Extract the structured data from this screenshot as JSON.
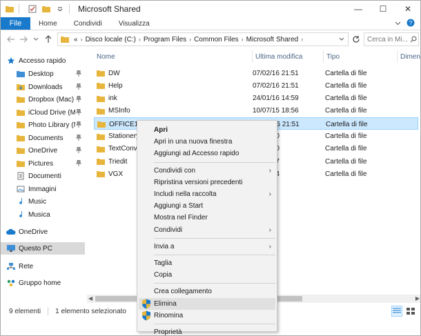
{
  "window": {
    "title": "Microsoft Shared",
    "controls": {
      "minimize": "—",
      "maximize": "☐",
      "close": "✕"
    }
  },
  "ribbon": {
    "tabs": [
      "File",
      "Home",
      "Condividi",
      "Visualizza"
    ]
  },
  "address": {
    "prefix": "«",
    "segments": [
      "Disco locale (C:)",
      "Program Files",
      "Common Files",
      "Microsoft Shared"
    ],
    "search_placeholder": "Cerca in Mi..."
  },
  "sidebar": {
    "items": [
      {
        "label": "Accesso rapido",
        "icon": "star-icon",
        "pin": false
      },
      {
        "label": "Desktop",
        "icon": "folder-blue-icon",
        "pin": true
      },
      {
        "label": "Downloads",
        "icon": "download-icon",
        "pin": true
      },
      {
        "label": "Dropbox (Mac)",
        "icon": "folder-icon",
        "pin": true
      },
      {
        "label": "iCloud Drive (Ma",
        "icon": "folder-icon",
        "pin": true
      },
      {
        "label": "Photo Library (M",
        "icon": "folder-icon",
        "pin": true
      },
      {
        "label": "Documents",
        "icon": "folder-icon",
        "pin": true
      },
      {
        "label": "OneDrive",
        "icon": "folder-icon",
        "pin": true
      },
      {
        "label": "Pictures",
        "icon": "folder-icon",
        "pin": true
      },
      {
        "label": "Documenti",
        "icon": "documents-icon",
        "pin": false
      },
      {
        "label": "Immagini",
        "icon": "pictures-icon",
        "pin": false
      },
      {
        "label": "Music",
        "icon": "music-icon",
        "pin": false
      },
      {
        "label": "Musica",
        "icon": "music-icon",
        "pin": false
      },
      {
        "label": "OneDrive",
        "icon": "cloud-icon",
        "pin": false
      },
      {
        "label": "Questo PC",
        "icon": "computer-icon",
        "pin": false,
        "selected": true
      },
      {
        "label": "Rete",
        "icon": "network-icon",
        "pin": false
      },
      {
        "label": "Gruppo home",
        "icon": "homegroup-icon",
        "pin": false
      }
    ]
  },
  "columns": [
    "Nome",
    "Ultima modifica",
    "Tipo",
    "Dimensi"
  ],
  "files": [
    {
      "name": "DW",
      "date": "07/02/16 21:51",
      "type": "Cartella di file"
    },
    {
      "name": "Help",
      "date": "07/02/16 21:51",
      "type": "Cartella di file"
    },
    {
      "name": "ink",
      "date": "24/01/16 14:59",
      "type": "Cartella di file"
    },
    {
      "name": "MSInfo",
      "date": "10/07/15 18:56",
      "type": "Cartella di file"
    },
    {
      "name": "OFFICE15",
      "date": "07/02/16 21:51",
      "type": "Cartella di file",
      "selected": true
    },
    {
      "name": "Stationery",
      "date": "15 19:00",
      "type": "Cartella di file"
    },
    {
      "name": "TextConv",
      "date": "16 21:50",
      "type": "Cartella di file"
    },
    {
      "name": "Triedit",
      "date": "16 14:57",
      "type": "Cartella di file"
    },
    {
      "name": "VGX",
      "date": "15 13:04",
      "type": "Cartella di file"
    }
  ],
  "status": {
    "count": "9 elementi",
    "selection": "1 elemento selezionato"
  },
  "context_menu": {
    "items": [
      {
        "label": "Apri",
        "bold": true
      },
      {
        "label": "Apri in una nuova finestra"
      },
      {
        "label": "Aggiungi ad Accesso rapido"
      },
      {
        "sep": true
      },
      {
        "label": "Condividi con",
        "submenu": true
      },
      {
        "label": "Ripristina versioni precedenti"
      },
      {
        "label": "Includi nella raccolta",
        "submenu": true
      },
      {
        "label": "Aggiungi a Start"
      },
      {
        "label": "Mostra nel Finder"
      },
      {
        "label": "Condividi",
        "submenu": true
      },
      {
        "sep": true
      },
      {
        "label": "Invia a",
        "submenu": true
      },
      {
        "sep": true
      },
      {
        "label": "Taglia"
      },
      {
        "label": "Copia"
      },
      {
        "sep": true
      },
      {
        "label": "Crea collegamento"
      },
      {
        "label": "Elimina",
        "shield": true,
        "hover": true
      },
      {
        "label": "Rinomina",
        "shield": true
      },
      {
        "sep": true
      },
      {
        "label": "Proprietà"
      }
    ]
  },
  "colors": {
    "accent": "#1979ca",
    "folder": "#e8b53c",
    "selection": "#cce8ff",
    "menu_bg": "#f2f2f2"
  }
}
